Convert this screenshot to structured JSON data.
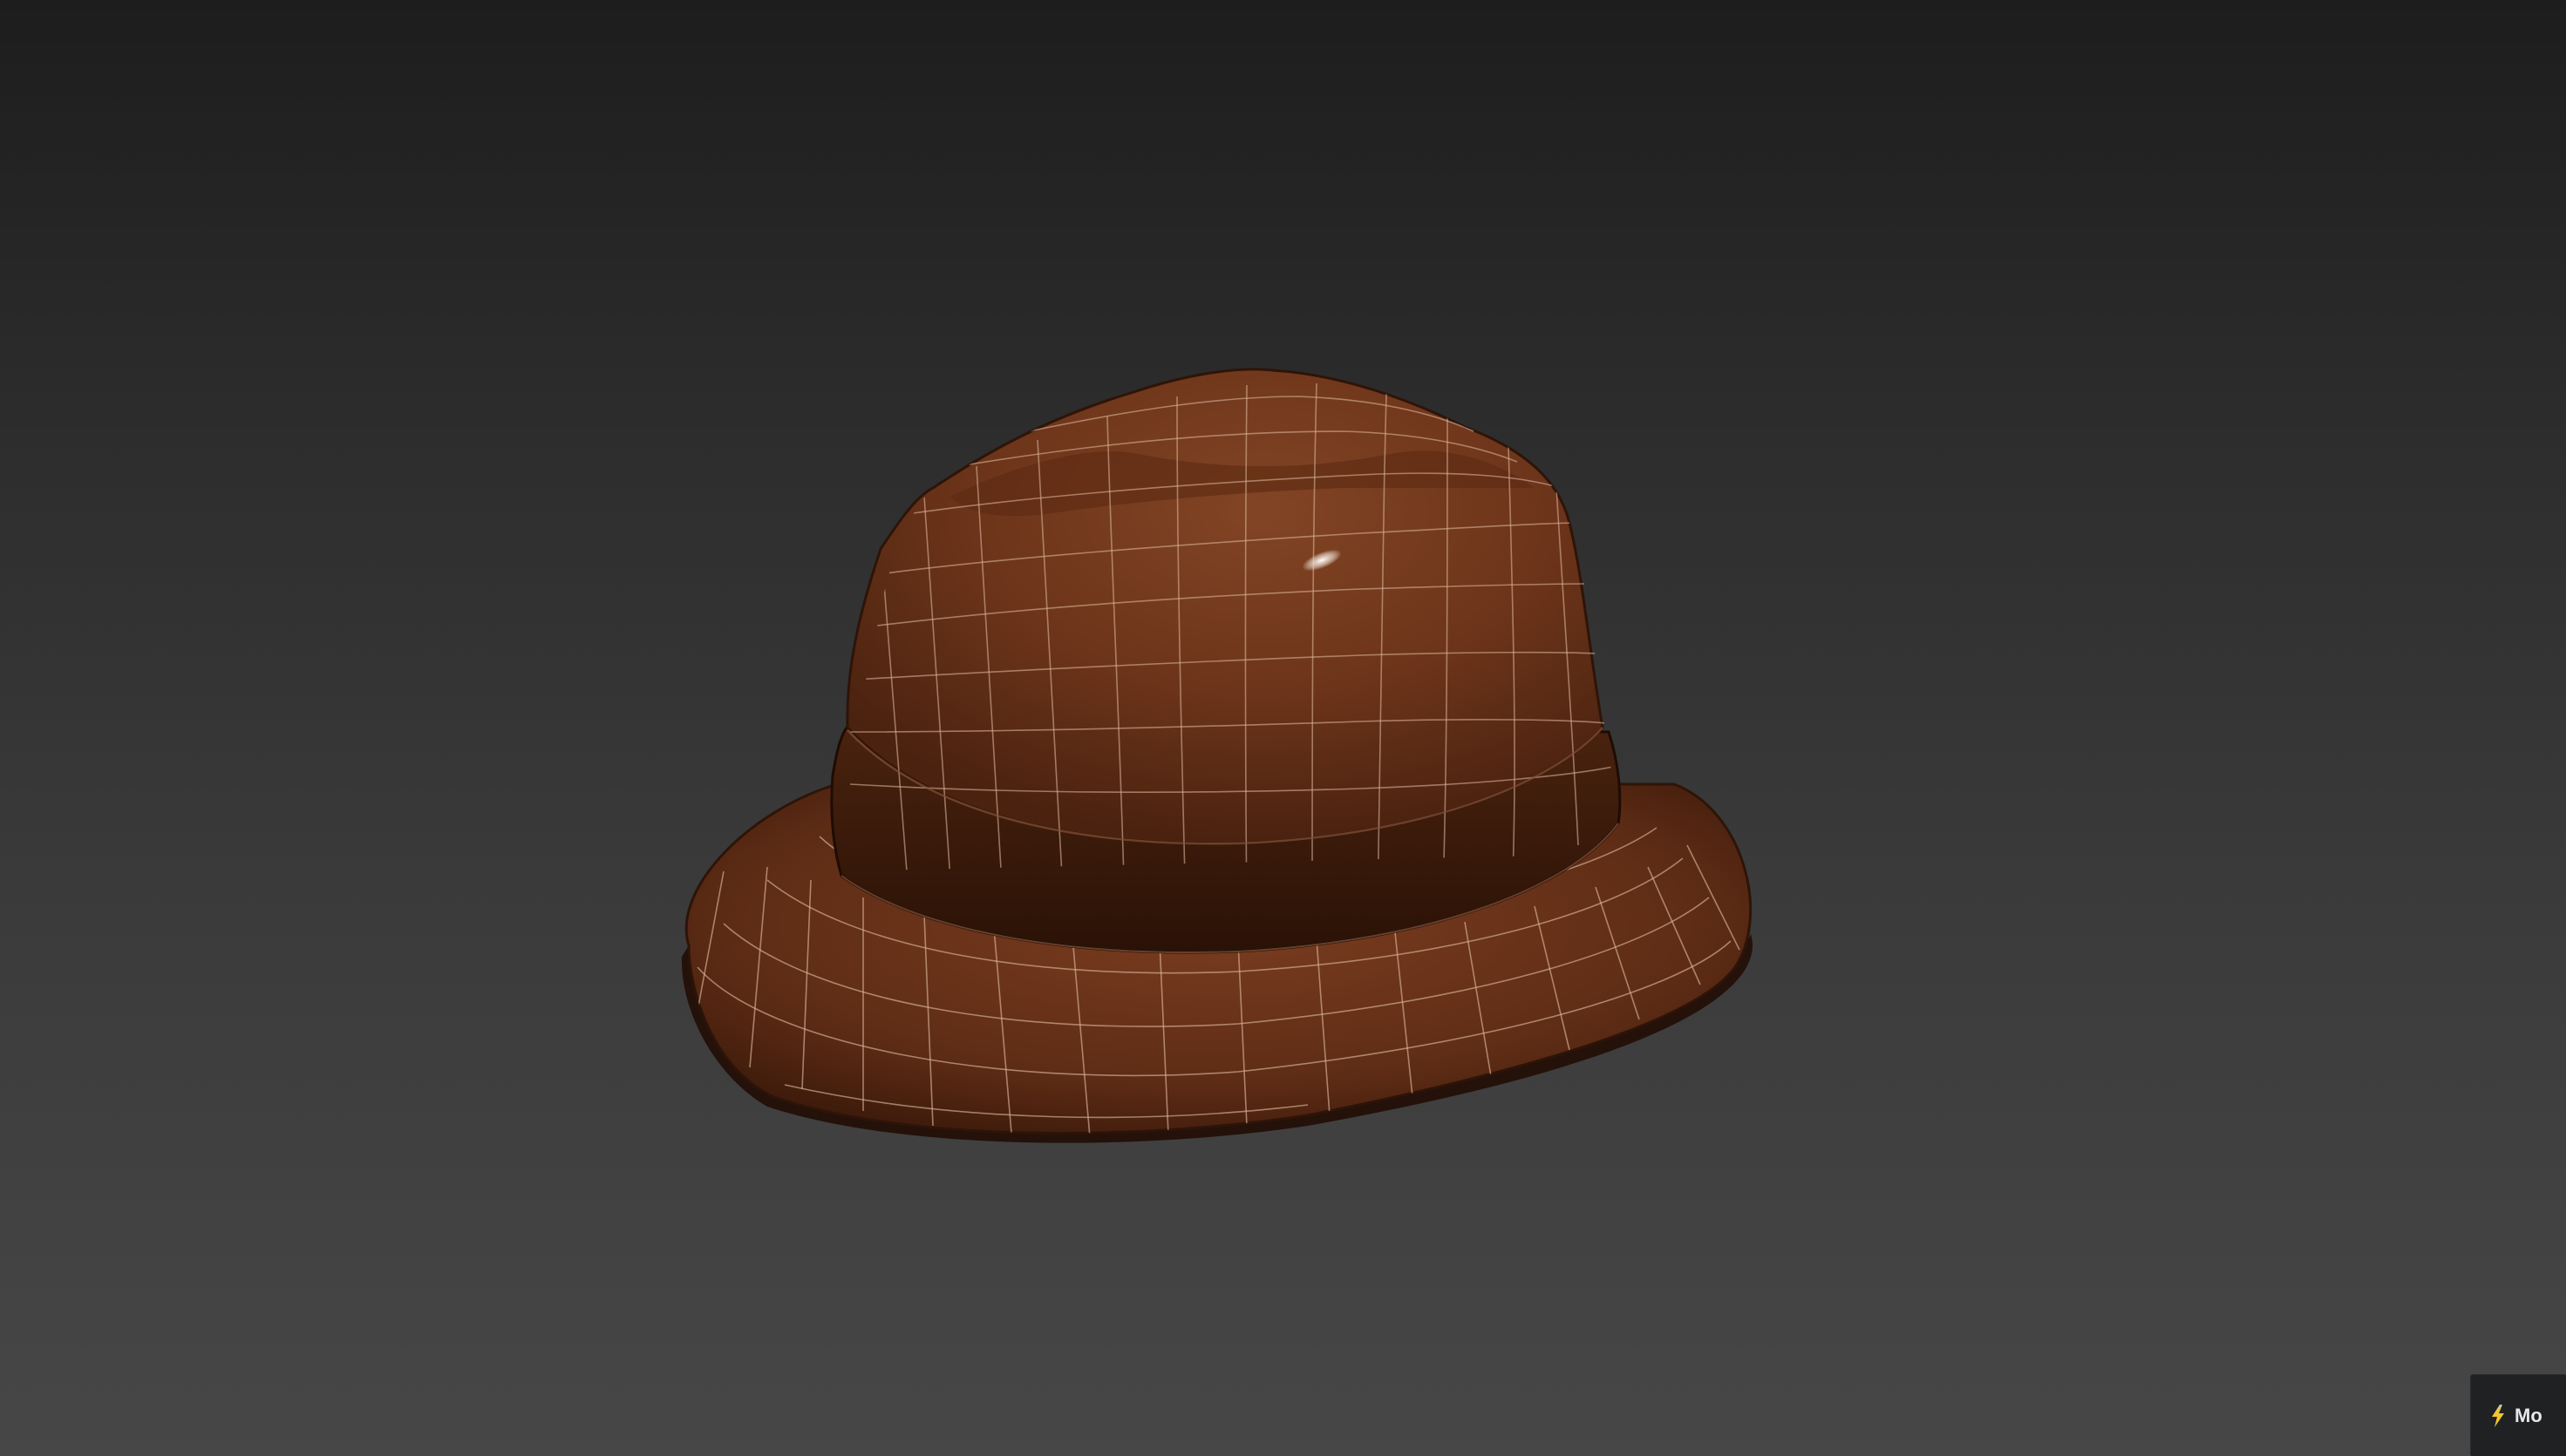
{
  "viewport": {
    "background_top": "#1d1d1d",
    "background_bottom": "#474747"
  },
  "model": {
    "object": "hat-icon",
    "material_color": "#6a341c",
    "band_color": "#3f1d0c",
    "wireframe_color": "#d8b39a",
    "specular_highlight": "#ffffff"
  },
  "corner_widget": {
    "icon": "lightning-bolt-icon",
    "label": "Mo"
  }
}
